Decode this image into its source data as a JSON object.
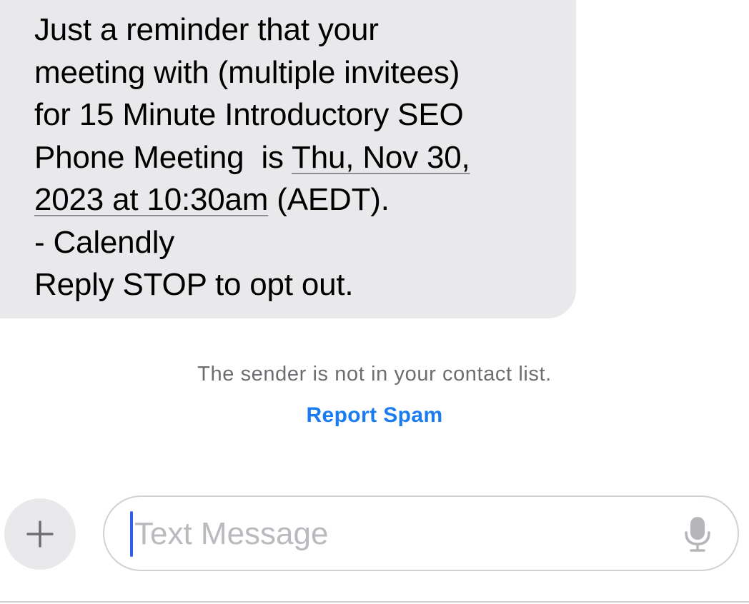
{
  "message": {
    "lines": [
      "Just a reminder that your",
      "meeting with (multiple invitees)",
      "for 15 Minute Introductory SEO",
      "Phone Meeting  is "
    ],
    "date_link_part1": "Thu, Nov 30,",
    "date_link_part2": "2023 at 10:30am",
    "timezone_suffix": " (AEDT).",
    "signature": "- Calendly",
    "opt_out": "Reply STOP to opt out."
  },
  "notice": {
    "text": "The sender is not in your contact list.",
    "report_spam_label": "Report Spam"
  },
  "compose": {
    "plus_label": "+",
    "placeholder": "Text Message",
    "value": ""
  },
  "icons": {
    "plus": "plus-icon",
    "mic": "microphone-icon"
  },
  "colors": {
    "bubble": "#e9e9eb",
    "link": "#1b7bf0",
    "caret": "#2f5fe8",
    "notice_text": "#6d6d72"
  }
}
